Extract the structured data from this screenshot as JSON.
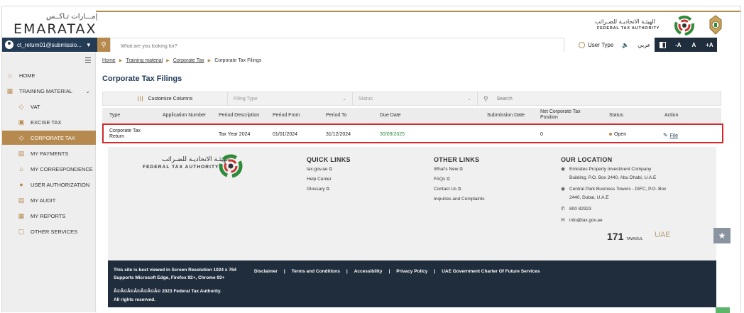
{
  "header": {
    "logo_ar": "إمـــارات تـاكــس",
    "logo_en": "EMARATAX",
    "fta_ar": "الهيئـة الاتحاديـة للضـرائب",
    "fta_en": "FEDERAL TAX AUTHORITY"
  },
  "toolbar": {
    "user": "ct_return01@submissio...",
    "search_placeholder": "What are you looking for?",
    "user_type": "User Type",
    "arabic": "عربي",
    "font_minus": "-A",
    "font_normal": "A",
    "font_plus": "+A"
  },
  "sidebar": {
    "items": [
      {
        "label": "HOME",
        "icon": "home-icon"
      },
      {
        "label": "TRAINING MATERIAL",
        "icon": "grid-icon"
      },
      {
        "label": "VAT",
        "icon": "vat-icon"
      },
      {
        "label": "EXCISE TAX",
        "icon": "excise-icon"
      },
      {
        "label": "CORPORATE TAX",
        "icon": "corporate-icon"
      },
      {
        "label": "MY PAYMENTS",
        "icon": "payments-icon"
      },
      {
        "label": "MY CORRESPONDENCE",
        "icon": "correspondence-icon"
      },
      {
        "label": "USER AUTHORIZATION",
        "icon": "user-auth-icon"
      },
      {
        "label": "MY AUDIT",
        "icon": "audit-icon"
      },
      {
        "label": "MY REPORTS",
        "icon": "reports-icon"
      },
      {
        "label": "OTHER SERVICES",
        "icon": "services-icon"
      }
    ]
  },
  "breadcrumb": {
    "home": "Home",
    "training": "Training material",
    "corporate": "Corporate Tax",
    "current": "Corporate Tax Filings"
  },
  "page": {
    "title": "Corporate Tax Filings"
  },
  "filters": {
    "customize": "Customize Columns",
    "filing_type": "Filing Type",
    "status": "Status",
    "search": "Search"
  },
  "table": {
    "headers": {
      "type": "Type",
      "app_no": "Application Number",
      "period_desc": "Period Description",
      "period_from": "Period From",
      "period_to": "Period To",
      "due_date": "Due Date",
      "submission_date": "Submission Date",
      "net_ct_1": "Net Corporate Tax",
      "net_ct_2": "Position",
      "status": "Status",
      "action": "Action"
    },
    "row": {
      "type_1": "Corporate Tax",
      "type_2": "Return",
      "app_no": "",
      "period_desc": "Tax Year 2024",
      "period_from": "01/01/2024",
      "period_to": "31/12/2024",
      "due_date": "30/09/2025",
      "submission_date": "",
      "net_ct": "0",
      "status": "Open",
      "action": "File"
    }
  },
  "footer": {
    "fta_ar": "الهيئـة الاتحاديـة للضـرائب",
    "fta_en": "FEDERAL TAX AUTHORITY",
    "quick_links_title": "QUICK LINKS",
    "quick_links": [
      "tax.gov.ae",
      "Help Center",
      "Glossary"
    ],
    "other_links_title": "OTHER LINKS",
    "other_links": [
      "What's New",
      "FAQs",
      "Contact Us",
      "Inquiries and Complaints"
    ],
    "location_title": "OUR LOCATION",
    "loc1_a": "Emirates Property Investment Company",
    "loc1_b": "Building, P.O. Box 2440, Abu Dhabi, U.A.E",
    "loc2_a": "Central Park Business Towers - DIFC, P.O. Box",
    "loc2_b": "2440, Dubai, U.A.E",
    "phone": "800 82923",
    "email": "info@tax.gov.ae",
    "logo_171": "171",
    "logo_tawasul": "TAWASUL",
    "logo_uae": "UAE"
  },
  "bottom": {
    "resolution_1": "This site is best viewed in Screen Resolution 1024 x 764",
    "resolution_2": "Supports Microsoft Edge, Firefox 92+, Chrome 93+",
    "links": [
      "Disclaimer",
      "Terms and Conditions",
      "Accessibility",
      "Privacy Policy",
      "UAE Government Charter Of Future Services"
    ],
    "copyright_1": "Â©Â©Â©Â©Â©Â©Â© 2023 Federal Tax Authority.",
    "copyright_2": "All rights reserved."
  },
  "colors": {
    "accent": "#b68a4f",
    "navy": "#1f2d3d",
    "highlight": "#d12a2a",
    "due_green": "#2e8b3a"
  }
}
